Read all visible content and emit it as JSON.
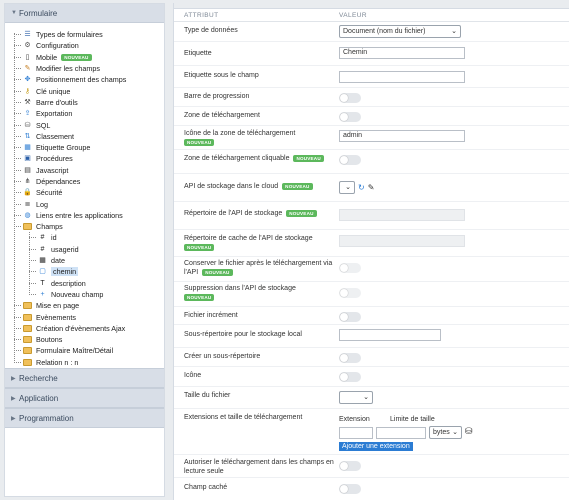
{
  "sidebar": {
    "header": "Formulaire",
    "items": [
      {
        "label": "Types de formulaires",
        "icon": "list-icon",
        "level": 0
      },
      {
        "label": "Configuration",
        "icon": "gear-icon",
        "level": 0
      },
      {
        "label": "Mobile",
        "icon": "mobile-icon",
        "level": 0,
        "badge": "NOUVEAU"
      },
      {
        "label": "Modifier les champs",
        "icon": "edit-icon",
        "level": 0
      },
      {
        "label": "Positionnement des champs",
        "icon": "move-icon",
        "level": 0
      },
      {
        "label": "Clé unique",
        "icon": "key-icon",
        "level": 0
      },
      {
        "label": "Barre d'outils",
        "icon": "wrench-icon",
        "level": 0
      },
      {
        "label": "Exportation",
        "icon": "export-icon",
        "level": 0
      },
      {
        "label": "SQL",
        "icon": "database-icon",
        "level": 0
      },
      {
        "label": "Classement",
        "icon": "sort-icon",
        "level": 0
      },
      {
        "label": "Etiquette Groupe",
        "icon": "table-icon",
        "level": 0
      },
      {
        "label": "Procédures",
        "icon": "procedure-icon",
        "level": 0
      },
      {
        "label": "Javascript",
        "icon": "javascript-icon",
        "level": 0
      },
      {
        "label": "Dépendances",
        "icon": "dependency-icon",
        "level": 0
      },
      {
        "label": "Sécurité",
        "icon": "lock-icon",
        "level": 0
      },
      {
        "label": "Log",
        "icon": "log-icon",
        "level": 0
      },
      {
        "label": "Liens entre les applications",
        "icon": "globe-icon",
        "level": 0
      },
      {
        "label": "Champs",
        "icon": "folder-icon",
        "level": 0
      },
      {
        "label": "id",
        "icon": "hash-icon",
        "level": 1
      },
      {
        "label": "usagerid",
        "icon": "hash-icon",
        "level": 1
      },
      {
        "label": "date",
        "icon": "calendar-icon",
        "level": 1
      },
      {
        "label": "chemin",
        "icon": "file-icon",
        "level": 1,
        "selected": true
      },
      {
        "label": "description",
        "icon": "text-icon",
        "level": 1
      },
      {
        "label": "Nouveau champ",
        "icon": "plus-icon",
        "level": 1
      },
      {
        "label": "Mise en page",
        "icon": "folder-icon",
        "level": 0
      },
      {
        "label": "Evènements",
        "icon": "folder-icon",
        "level": 0
      },
      {
        "label": "Création d'évènements Ajax",
        "icon": "folder-icon",
        "level": 0
      },
      {
        "label": "Boutons",
        "icon": "folder-icon",
        "level": 0
      },
      {
        "label": "Formulaire Maître/Détail",
        "icon": "folder-icon",
        "level": 0
      },
      {
        "label": "Relation n : n",
        "icon": "folder-icon",
        "level": 0
      }
    ],
    "sections": [
      "Recherche",
      "Application",
      "Programmation"
    ]
  },
  "main": {
    "col_attr": "ATTRIBUT",
    "col_val": "VALEUR",
    "badge": "NOUVEAU",
    "rows": {
      "type": {
        "label": "Type de données",
        "value": "Document (nom du fichier)"
      },
      "etiquette": {
        "label": "Etiquette",
        "value": "Chemin"
      },
      "sous_champ": {
        "label": "Etiquette sous le champ",
        "value": ""
      },
      "progression": {
        "label": "Barre de progression"
      },
      "zone": {
        "label": "Zone de téléchargement"
      },
      "icone_zone": {
        "label": "Icône de la zone de téléchargement",
        "value": "admin"
      },
      "zone_cliquable": {
        "label": "Zone de téléchargement cliquable"
      },
      "api": {
        "label": "API de stockage dans le cloud"
      },
      "repertoire": {
        "label": "Répertoire de l'API de stockage"
      },
      "cache": {
        "label": "Répertoire de cache de l'API de stockage"
      },
      "conserver": {
        "label": "Conserver le fichier après le téléchargement via l'API"
      },
      "suppression": {
        "label": "Suppression dans l'API de stockage"
      },
      "increment": {
        "label": "Fichier incrément"
      },
      "sous_rep": {
        "label": "Sous-répertoire pour le stockage local",
        "value": ""
      },
      "creer": {
        "label": "Créer un sous-répertoire"
      },
      "icone": {
        "label": "Icône"
      },
      "taille": {
        "label": "Taille du fichier",
        "value": ""
      },
      "extensions": {
        "label": "Extensions et taille de téléchargement",
        "ext_label": "Extension",
        "limit_label": "Limite de taille",
        "unit": "bytes",
        "add_button": "Ajouter une extension"
      },
      "autoriser": {
        "label": "Autoriser le téléchargement dans les champs en lecture seule"
      },
      "cache_champ": {
        "label": "Champ caché"
      }
    }
  }
}
